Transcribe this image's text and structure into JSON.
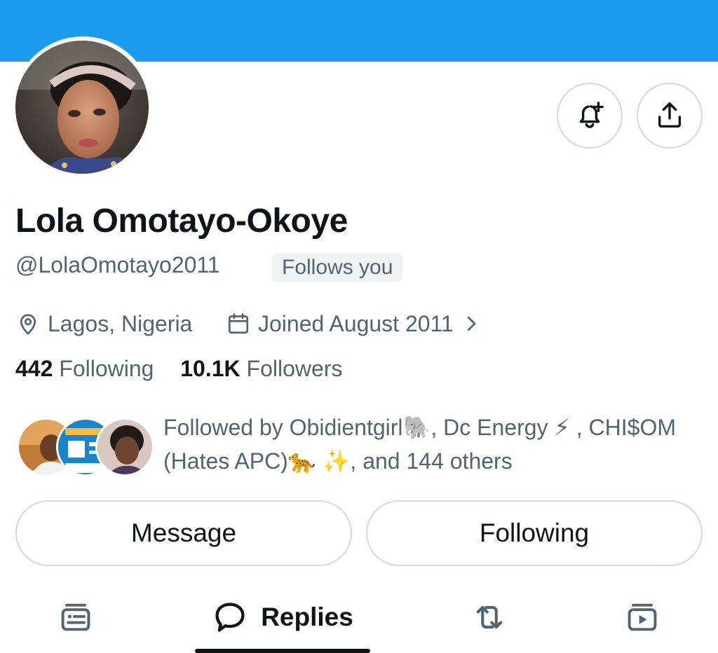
{
  "profile": {
    "display_name": "Lola Omotayo-Okoye",
    "handle": "@LolaOmotayo2011",
    "follows_you": "Follows you",
    "location": "Lagos,  Nigeria",
    "joined": "Joined August 2011",
    "following_count": "442",
    "following_label": "Following",
    "followers_count": "10.1K",
    "followers_label": "Followers",
    "followed_by": "Followed by Obidientgirl🐘, Dc Energy ⚡ , CHI$OM (Hates APC)🐆 ✨, and 144 others"
  },
  "actions": {
    "message_label": "Message",
    "following_label": "Following"
  },
  "tabs": {
    "active_label": "Replies"
  },
  "icons": {
    "notify": "bell-plus-icon",
    "share": "share-icon",
    "location": "location-pin-icon",
    "calendar": "calendar-icon",
    "chevron": "chevron-right-icon",
    "tab_posts": "posts-icon",
    "tab_replies": "speech-bubble-icon",
    "tab_reposts": "repost-icon",
    "tab_media": "media-icon"
  },
  "colors": {
    "banner": "#1d9bf0",
    "text_primary": "#0f1419",
    "text_secondary": "#536471",
    "border": "#cfd9de"
  }
}
